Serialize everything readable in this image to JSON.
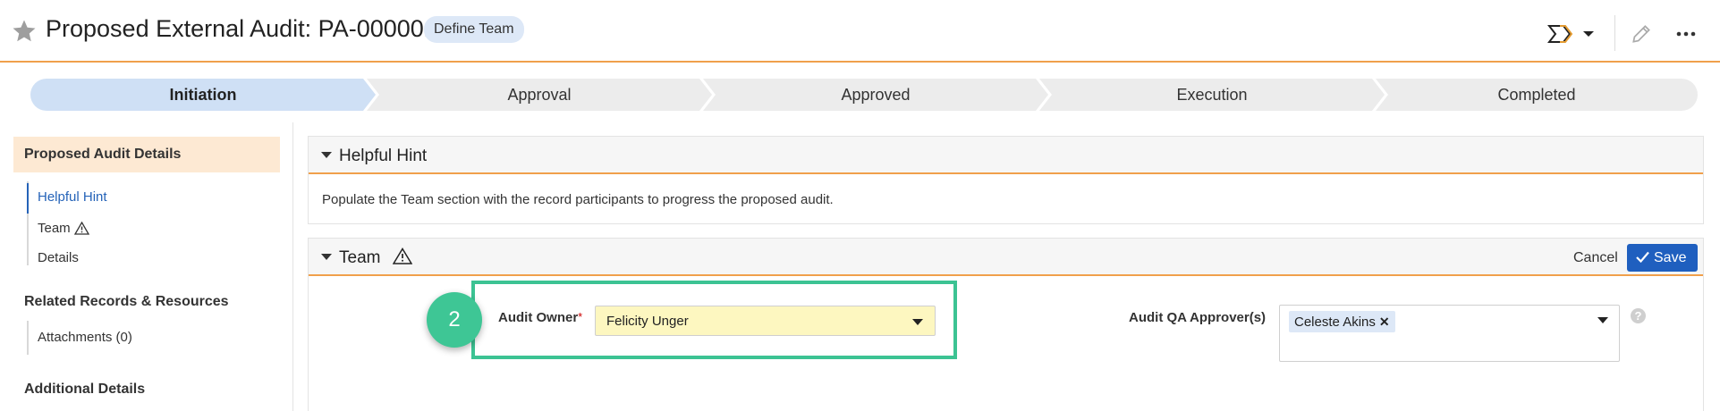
{
  "header": {
    "title": "Proposed External Audit: PA-000001",
    "badge": "Define Team",
    "icons": [
      "star-icon",
      "workflow-icon",
      "chevron-down-icon",
      "pencil-icon",
      "more-icon"
    ]
  },
  "stepper": {
    "steps": [
      "Initiation",
      "Approval",
      "Approved",
      "Execution",
      "Completed"
    ],
    "active_index": 0,
    "colors": {
      "active": "#cfe0f5",
      "inactive": "#ececec"
    }
  },
  "leftnav": {
    "section_title": "Proposed Audit Details",
    "items": [
      "Helpful Hint",
      "Team",
      "Details"
    ],
    "selected": "Helpful Hint",
    "related_title": "Related Records & Resources",
    "related_items": [
      "Attachments (0)"
    ],
    "additional_title": "Additional Details"
  },
  "hint_panel": {
    "title": "Helpful Hint",
    "text": "Populate the Team section with the record participants to progress the proposed audit."
  },
  "team_panel": {
    "title": "Team",
    "cancel_label": "Cancel",
    "save_label": "Save",
    "audit_owner": {
      "label": "Audit Owner",
      "required_mark": "*",
      "value": "Felicity Unger"
    },
    "qa_approvers": {
      "label": "Audit QA Approver(s)",
      "chips": [
        "Celeste Akins"
      ],
      "help": "?"
    }
  },
  "callout": {
    "number": "2",
    "color": "#3ec695"
  },
  "accent_colors": {
    "orange": "#f0a04b",
    "blue": "#1f5fbf",
    "highlight": "#3cc393"
  }
}
